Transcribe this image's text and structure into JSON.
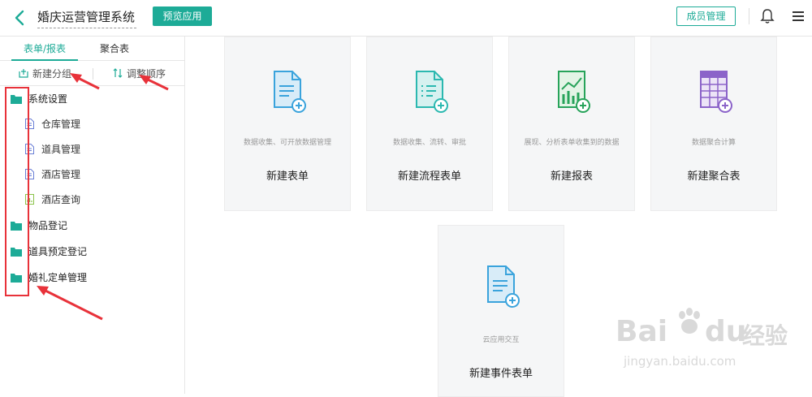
{
  "header": {
    "title": "婚庆运营管理系统",
    "preview_label": "预览应用",
    "member_label": "成员管理",
    "icons": [
      "back-arrow-icon",
      "bell-icon",
      "menu-icon"
    ]
  },
  "sidebar": {
    "tabs": [
      {
        "label": "表单/报表",
        "active": true
      },
      {
        "label": "聚合表",
        "active": false
      }
    ],
    "actions": [
      {
        "label": "新建分组",
        "icon": "add-group-icon"
      },
      {
        "label": "调整顺序",
        "icon": "sort-icon"
      }
    ],
    "tree": [
      {
        "label": "系统设置",
        "type": "folder"
      },
      {
        "label": "仓库管理",
        "type": "form"
      },
      {
        "label": "道具管理",
        "type": "form"
      },
      {
        "label": "酒店管理",
        "type": "form"
      },
      {
        "label": "酒店查询",
        "type": "report"
      },
      {
        "label": "物品登记",
        "type": "folder"
      },
      {
        "label": "道具预定登记",
        "type": "folder"
      },
      {
        "label": "婚礼定单管理",
        "type": "folder"
      }
    ]
  },
  "cards": [
    {
      "desc": "数据收集、可开放数据管理",
      "title": "新建表单",
      "icon": "form-doc-icon"
    },
    {
      "desc": "数据收集、流转、审批",
      "title": "新建流程表单",
      "icon": "flow-doc-icon"
    },
    {
      "desc": "展现、分析表单收集到的数据",
      "title": "新建报表",
      "icon": "report-chart-icon"
    },
    {
      "desc": "数据聚合计算",
      "title": "新建聚合表",
      "icon": "aggregate-table-icon"
    },
    {
      "desc": "云应用交互",
      "title": "新建事件表单",
      "icon": "event-doc-icon"
    }
  ],
  "colors": {
    "accent": "#1dab97",
    "annotation": "#e8323a",
    "card_bg": "#f5f6f7"
  },
  "watermark": {
    "brand": "Bai",
    "brand_tail": "du",
    "cn": "经验",
    "url": "jingyan.baidu.com"
  }
}
